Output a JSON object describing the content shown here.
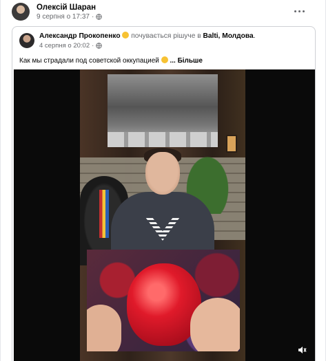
{
  "post": {
    "author": "Олексій Шаран",
    "timestamp": "9 серпня о 17:37",
    "audience_icon": "globe-icon",
    "more_icon": "more-options-icon"
  },
  "shared_post": {
    "author": "Александр Прокопенко",
    "feeling": "почувається рішуче в",
    "location": "Balti, Молдова",
    "location_suffix": ".",
    "timestamp": "4 серпня о 20:02",
    "text": "Как мы страдали под советской оккупацией",
    "see_more": "... Більше"
  },
  "video": {
    "volume_icon": "volume-icon"
  },
  "colors": {
    "primary_text": "#050505",
    "secondary_text": "#65676b",
    "border": "#ced0d4"
  }
}
